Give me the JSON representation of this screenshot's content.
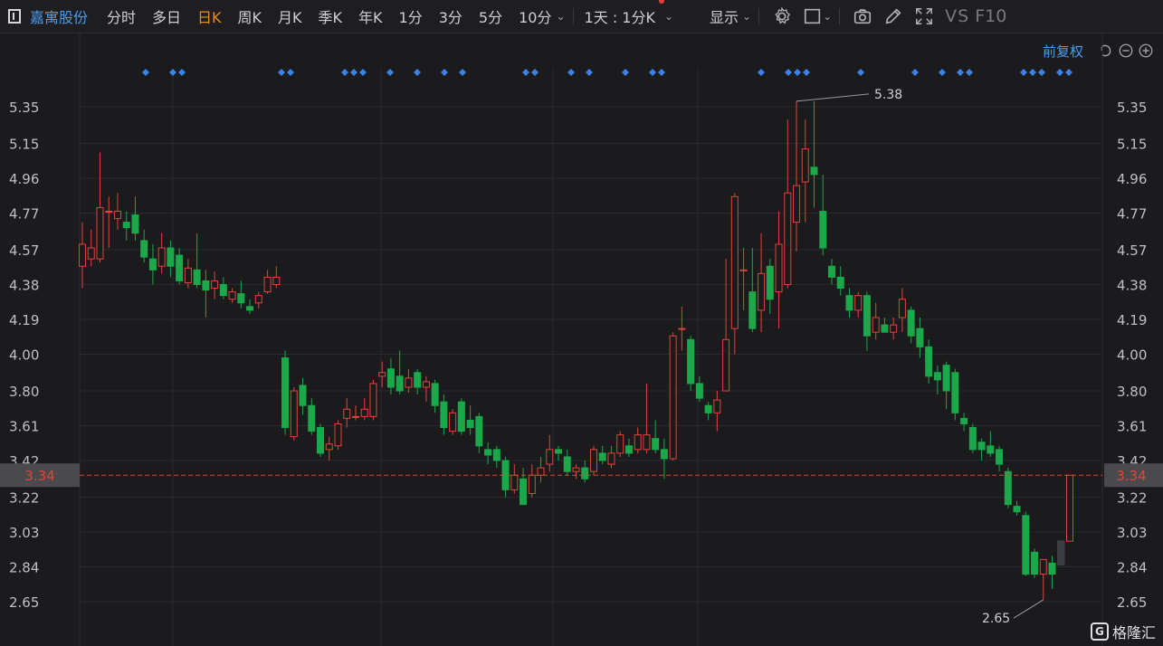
{
  "toolbar": {
    "stock_name": "嘉寓股份",
    "tabs": [
      {
        "label": "分时",
        "active": false
      },
      {
        "label": "多日",
        "active": false
      },
      {
        "label": "日K",
        "active": true
      },
      {
        "label": "周K",
        "active": false
      },
      {
        "label": "月K",
        "active": false
      },
      {
        "label": "季K",
        "active": false
      },
      {
        "label": "年K",
        "active": false
      },
      {
        "label": "1分",
        "active": false
      },
      {
        "label": "3分",
        "active": false
      },
      {
        "label": "5分",
        "active": false
      },
      {
        "label": "10分",
        "active": false
      }
    ],
    "period_label": "1天 : 1分K",
    "display_label": "显示",
    "vs_label": "VS",
    "f10_label": "F10"
  },
  "subbar": {
    "adjust_label": "前复权"
  },
  "watermark": {
    "label": "格隆汇"
  },
  "colors": {
    "up": "#e0443a",
    "down": "#1aa84a",
    "price_line": "#e0443a",
    "marker": "#3b82e8",
    "accent": "#f08a24",
    "link": "#4a9df0"
  },
  "chart_data": {
    "type": "candlestick",
    "y_ticks": [
      "5.35",
      "5.15",
      "4.96",
      "4.77",
      "4.57",
      "4.38",
      "4.19",
      "4.00",
      "3.80",
      "3.61",
      "3.42",
      "3.22",
      "3.03",
      "2.84",
      "2.65"
    ],
    "ylim": [
      2.55,
      5.48
    ],
    "current_price": "3.34",
    "high_label": "5.38",
    "low_label": "2.65",
    "candles": [
      [
        4.48,
        4.6,
        4.72,
        4.36
      ],
      [
        4.52,
        4.58,
        4.68,
        4.48
      ],
      [
        4.52,
        4.8,
        5.1,
        4.5
      ],
      [
        4.78,
        4.78,
        4.86,
        4.58
      ],
      [
        4.74,
        4.78,
        4.88,
        4.68
      ],
      [
        4.72,
        4.69,
        4.78,
        4.62
      ],
      [
        4.76,
        4.66,
        4.86,
        4.62
      ],
      [
        4.62,
        4.53,
        4.68,
        4.5
      ],
      [
        4.52,
        4.46,
        4.6,
        4.38
      ],
      [
        4.48,
        4.58,
        4.66,
        4.44
      ],
      [
        4.58,
        4.48,
        4.62,
        4.42
      ],
      [
        4.54,
        4.4,
        4.58,
        4.38
      ],
      [
        4.39,
        4.47,
        4.52,
        4.36
      ],
      [
        4.46,
        4.38,
        4.66,
        4.36
      ],
      [
        4.4,
        4.35,
        4.46,
        4.2
      ],
      [
        4.36,
        4.4,
        4.45,
        4.3
      ],
      [
        4.38,
        4.32,
        4.42,
        4.3
      ],
      [
        4.3,
        4.34,
        4.36,
        4.28
      ],
      [
        4.33,
        4.28,
        4.4,
        4.25
      ],
      [
        4.26,
        4.24,
        4.3,
        4.22
      ],
      [
        4.28,
        4.32,
        4.34,
        4.25
      ],
      [
        4.34,
        4.42,
        4.46,
        4.33
      ],
      [
        4.38,
        4.42,
        4.48,
        4.36
      ],
      [
        3.98,
        3.6,
        4.02,
        3.56
      ],
      [
        3.55,
        3.8,
        3.82,
        3.53
      ],
      [
        3.83,
        3.72,
        3.87,
        3.67
      ],
      [
        3.72,
        3.58,
        3.76,
        3.56
      ],
      [
        3.6,
        3.46,
        3.62,
        3.44
      ],
      [
        3.48,
        3.51,
        3.55,
        3.42
      ],
      [
        3.5,
        3.62,
        3.64,
        3.48
      ],
      [
        3.65,
        3.7,
        3.76,
        3.6
      ],
      [
        3.66,
        3.66,
        3.72,
        3.64
      ],
      [
        3.66,
        3.7,
        3.76,
        3.64
      ],
      [
        3.66,
        3.84,
        3.86,
        3.64
      ],
      [
        3.88,
        3.9,
        3.96,
        3.82
      ],
      [
        3.92,
        3.82,
        3.98,
        3.78
      ],
      [
        3.88,
        3.8,
        4.02,
        3.78
      ],
      [
        3.82,
        3.87,
        3.92,
        3.79
      ],
      [
        3.9,
        3.82,
        3.92,
        3.78
      ],
      [
        3.82,
        3.85,
        3.88,
        3.74
      ],
      [
        3.84,
        3.72,
        3.86,
        3.68
      ],
      [
        3.74,
        3.6,
        3.78,
        3.56
      ],
      [
        3.58,
        3.68,
        3.7,
        3.56
      ],
      [
        3.74,
        3.58,
        3.76,
        3.56
      ],
      [
        3.64,
        3.6,
        3.72,
        3.56
      ],
      [
        3.66,
        3.5,
        3.68,
        3.46
      ],
      [
        3.48,
        3.45,
        3.52,
        3.4
      ],
      [
        3.48,
        3.42,
        3.5,
        3.38
      ],
      [
        3.42,
        3.26,
        3.44,
        3.22
      ],
      [
        3.26,
        3.34,
        3.4,
        3.24
      ],
      [
        3.32,
        3.18,
        3.38,
        3.18
      ],
      [
        3.24,
        3.34,
        3.4,
        3.22
      ],
      [
        3.34,
        3.38,
        3.44,
        3.3
      ],
      [
        3.4,
        3.48,
        3.56,
        3.36
      ],
      [
        3.48,
        3.46,
        3.5,
        3.42
      ],
      [
        3.44,
        3.36,
        3.48,
        3.34
      ],
      [
        3.36,
        3.38,
        3.4,
        3.32
      ],
      [
        3.38,
        3.32,
        3.42,
        3.3
      ],
      [
        3.36,
        3.48,
        3.5,
        3.34
      ],
      [
        3.46,
        3.42,
        3.5,
        3.4
      ],
      [
        3.4,
        3.46,
        3.5,
        3.38
      ],
      [
        3.46,
        3.56,
        3.58,
        3.44
      ],
      [
        3.5,
        3.46,
        3.54,
        3.44
      ],
      [
        3.48,
        3.56,
        3.6,
        3.46
      ],
      [
        3.48,
        3.56,
        3.84,
        3.46
      ],
      [
        3.54,
        3.48,
        3.64,
        3.46
      ],
      [
        3.48,
        3.43,
        3.54,
        3.32
      ],
      [
        3.43,
        4.1,
        4.12,
        3.42
      ],
      [
        4.14,
        4.14,
        4.26,
        4.02
      ],
      [
        4.08,
        3.84,
        4.1,
        3.8
      ],
      [
        3.84,
        3.76,
        3.88,
        3.74
      ],
      [
        3.72,
        3.68,
        3.74,
        3.64
      ],
      [
        3.68,
        3.75,
        3.8,
        3.58
      ],
      [
        3.8,
        4.08,
        4.52,
        3.8
      ],
      [
        4.14,
        4.86,
        4.88,
        4.0
      ],
      [
        4.46,
        4.46,
        4.58,
        4.24
      ],
      [
        4.34,
        4.14,
        4.58,
        4.12
      ],
      [
        4.24,
        4.44,
        4.66,
        4.12
      ],
      [
        4.48,
        4.3,
        4.52,
        4.22
      ],
      [
        4.34,
        4.6,
        4.78,
        4.14
      ],
      [
        4.38,
        4.88,
        5.28,
        4.36
      ],
      [
        4.72,
        4.92,
        5.38,
        4.56
      ],
      [
        4.94,
        5.12,
        5.28,
        4.72
      ],
      [
        5.02,
        4.98,
        5.38,
        4.8
      ],
      [
        4.78,
        4.58,
        4.98,
        4.54
      ],
      [
        4.48,
        4.42,
        4.52,
        4.38
      ],
      [
        4.42,
        4.36,
        4.48,
        4.32
      ],
      [
        4.32,
        4.24,
        4.36,
        4.2
      ],
      [
        4.24,
        4.32,
        4.34,
        4.2
      ],
      [
        4.32,
        4.1,
        4.34,
        4.02
      ],
      [
        4.12,
        4.2,
        4.28,
        4.08
      ],
      [
        4.16,
        4.12,
        4.2,
        4.12
      ],
      [
        4.12,
        4.16,
        4.2,
        4.08
      ],
      [
        4.2,
        4.3,
        4.36,
        4.12
      ],
      [
        4.24,
        4.1,
        4.26,
        4.06
      ],
      [
        4.14,
        4.04,
        4.2,
        3.98
      ],
      [
        4.04,
        3.88,
        4.08,
        3.84
      ],
      [
        3.9,
        3.86,
        3.94,
        3.78
      ],
      [
        3.94,
        3.8,
        3.96,
        3.7
      ],
      [
        3.9,
        3.68,
        3.92,
        3.64
      ],
      [
        3.65,
        3.62,
        3.68,
        3.58
      ],
      [
        3.6,
        3.48,
        3.62,
        3.46
      ],
      [
        3.52,
        3.48,
        3.54,
        3.42
      ],
      [
        3.5,
        3.46,
        3.58,
        3.44
      ],
      [
        3.48,
        3.4,
        3.5,
        3.36
      ],
      [
        3.36,
        3.18,
        3.38,
        3.16
      ],
      [
        3.17,
        3.14,
        3.2,
        3.12
      ],
      [
        3.12,
        2.8,
        3.14,
        2.79
      ],
      [
        2.92,
        2.8,
        2.94,
        2.78
      ],
      [
        2.8,
        2.88,
        2.88,
        2.66
      ],
      [
        2.86,
        2.8,
        2.9,
        2.72
      ],
      [
        2.85,
        2.98,
        2.98,
        2.85
      ],
      [
        2.98,
        3.34,
        3.34,
        2.98
      ]
    ],
    "marker_positions": [
      161,
      191,
      201,
      311,
      321,
      381,
      391,
      401,
      431,
      461,
      491,
      511,
      581,
      591,
      631,
      651,
      691,
      721,
      731,
      841,
      871,
      881,
      891,
      951,
      1011,
      1041,
      1061,
      1071,
      1131,
      1141,
      1151,
      1171,
      1181
    ]
  }
}
